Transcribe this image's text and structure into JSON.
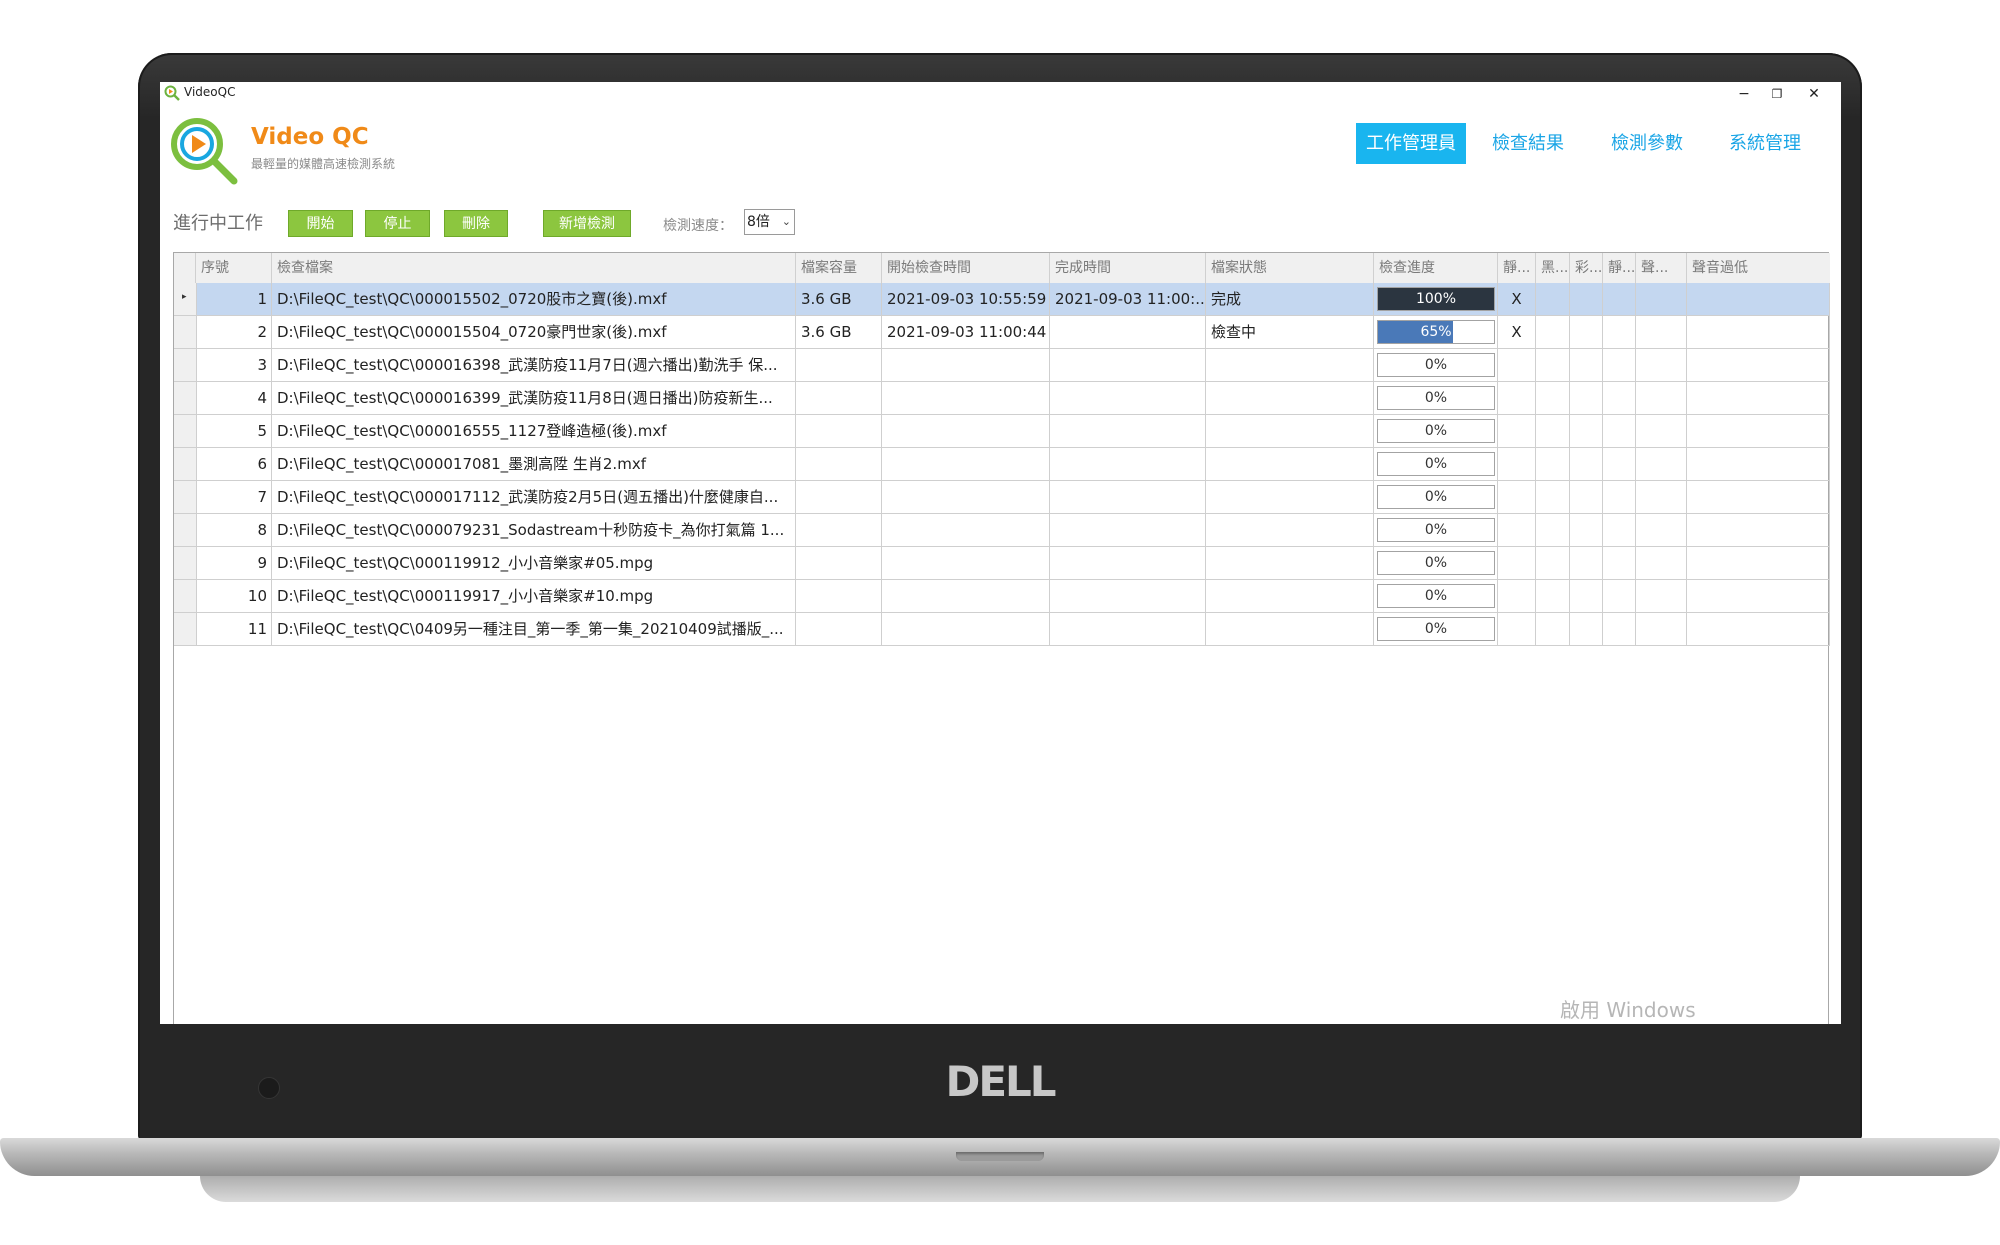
{
  "window": {
    "title": "VideoQC",
    "minimize": "−",
    "restore": "❐",
    "close": "✕"
  },
  "branding": {
    "title": "Video QC",
    "subtitle": "最輕量的媒體高速檢測系統",
    "device_logo": "DELL"
  },
  "nav": [
    {
      "label": "工作管理員",
      "active": true
    },
    {
      "label": "檢查結果",
      "active": false
    },
    {
      "label": "檢測參數",
      "active": false
    },
    {
      "label": "系統管理",
      "active": false
    }
  ],
  "toolbar": {
    "label": "進行中工作",
    "start": "開始",
    "stop": "停止",
    "delete": "刪除",
    "add": "新增檢測",
    "speed_label": "檢測速度：",
    "speed_value": "8倍"
  },
  "table": {
    "columns": [
      "序號",
      "檢查檔案",
      "檔案容量",
      "開始檢查時間",
      "完成時間",
      "檔案狀態",
      "檢查進度",
      "靜...",
      "黑...",
      "彩...",
      "靜...",
      "聲...",
      "聲音過低"
    ],
    "rows": [
      {
        "no": "1",
        "file": "D:\\FileQC_test\\QC\\000015502_0720股市之寶(後).mxf",
        "size": "3.6 GB",
        "start": "2021-09-03 10:55:59",
        "end": "2021-09-03 11:00:...",
        "status": "完成",
        "progress": 1.0,
        "progress_text": "100%",
        "c1": "X",
        "selected": true
      },
      {
        "no": "2",
        "file": "D:\\FileQC_test\\QC\\000015504_0720豪門世家(後).mxf",
        "size": "3.6 GB",
        "start": "2021-09-03 11:00:44",
        "end": "",
        "status": "檢查中",
        "progress": 0.65,
        "progress_text": "65%",
        "c1": "X",
        "selected": false
      },
      {
        "no": "3",
        "file": "D:\\FileQC_test\\QC\\000016398_武漢防疫11月7日(週六播出)勤洗手 保...",
        "size": "",
        "start": "",
        "end": "",
        "status": "",
        "progress": 0,
        "progress_text": "0%",
        "c1": "",
        "selected": false
      },
      {
        "no": "4",
        "file": "D:\\FileQC_test\\QC\\000016399_武漢防疫11月8日(週日播出)防疫新生...",
        "size": "",
        "start": "",
        "end": "",
        "status": "",
        "progress": 0,
        "progress_text": "0%",
        "c1": "",
        "selected": false
      },
      {
        "no": "5",
        "file": "D:\\FileQC_test\\QC\\000016555_1127登峰造極(後).mxf",
        "size": "",
        "start": "",
        "end": "",
        "status": "",
        "progress": 0,
        "progress_text": "0%",
        "c1": "",
        "selected": false
      },
      {
        "no": "6",
        "file": "D:\\FileQC_test\\QC\\000017081_墨測高陞 生肖2.mxf",
        "size": "",
        "start": "",
        "end": "",
        "status": "",
        "progress": 0,
        "progress_text": "0%",
        "c1": "",
        "selected": false
      },
      {
        "no": "7",
        "file": "D:\\FileQC_test\\QC\\000017112_武漢防疫2月5日(週五播出)什麼健康自...",
        "size": "",
        "start": "",
        "end": "",
        "status": "",
        "progress": 0,
        "progress_text": "0%",
        "c1": "",
        "selected": false
      },
      {
        "no": "8",
        "file": "D:\\FileQC_test\\QC\\000079231_Sodastream十秒防疫卡_為你打氣篇 1...",
        "size": "",
        "start": "",
        "end": "",
        "status": "",
        "progress": 0,
        "progress_text": "0%",
        "c1": "",
        "selected": false
      },
      {
        "no": "9",
        "file": "D:\\FileQC_test\\QC\\000119912_小小音樂家#05.mpg",
        "size": "",
        "start": "",
        "end": "",
        "status": "",
        "progress": 0,
        "progress_text": "0%",
        "c1": "",
        "selected": false
      },
      {
        "no": "10",
        "file": "D:\\FileQC_test\\QC\\000119917_小小音樂家#10.mpg",
        "size": "",
        "start": "",
        "end": "",
        "status": "",
        "progress": 0,
        "progress_text": "0%",
        "c1": "",
        "selected": false
      },
      {
        "no": "11",
        "file": "D:\\FileQC_test\\QC\\0409另一種注目_第一季_第一集_20210409試播版_...",
        "size": "",
        "start": "",
        "end": "",
        "status": "",
        "progress": 0,
        "progress_text": "0%",
        "c1": "",
        "selected": false
      }
    ]
  },
  "watermark": "啟用 Windows",
  "colors": {
    "accent": "#19b5ef",
    "button_green": "#8cc63f",
    "logo_orange": "#f08a18",
    "progress_done": "#2b3540",
    "progress_running": "#4a79b8",
    "selected_row": "#c4d7f0"
  },
  "icons": {
    "app": "magnifier-play-icon",
    "sort": "sort-ascending-icon",
    "row_pointer": "row-pointer-icon",
    "dropdown": "chevron-down-icon"
  }
}
